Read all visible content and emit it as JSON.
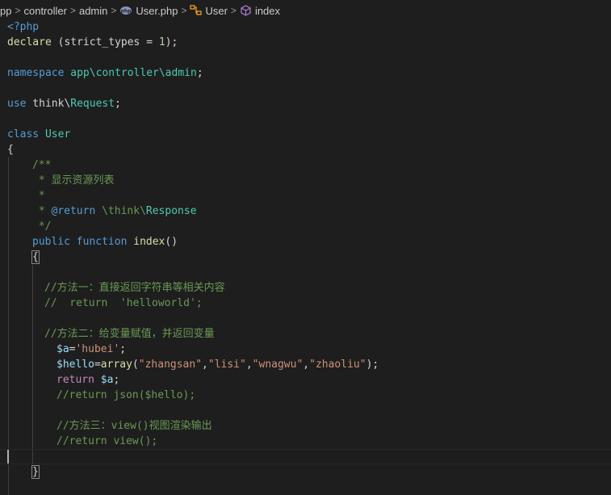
{
  "breadcrumb": {
    "items": [
      {
        "label": "pp",
        "icon": ""
      },
      {
        "label": "controller",
        "icon": ""
      },
      {
        "label": "admin",
        "icon": ""
      },
      {
        "label": "User.php",
        "icon": "php-file-icon"
      },
      {
        "label": "User",
        "icon": "class-icon"
      },
      {
        "label": "index",
        "icon": "method-icon"
      }
    ],
    "separator": ">"
  },
  "colors": {
    "background": "#1e1e1e",
    "keyword": "#569cd6",
    "control": "#c586c0",
    "function": "#dcdcaa",
    "type": "#4ec9b0",
    "variable": "#9cdcfe",
    "string": "#ce9178",
    "comment": "#6a9955",
    "number": "#b5cea8",
    "text": "#d4d4d4"
  },
  "code": {
    "l1": {
      "a": "<?php"
    },
    "l2": {
      "a": "declare",
      "b": " (strict_types = ",
      "c": "1",
      "d": ");"
    },
    "l4": {
      "a": "namespace",
      "b": " ",
      "c": "app\\controller\\admin",
      "d": ";"
    },
    "l6": {
      "a": "use",
      "b": " think\\",
      "c": "Request",
      "d": ";"
    },
    "l8": {
      "a": "class",
      "b": " ",
      "c": "User"
    },
    "l9": {
      "a": "{"
    },
    "l10": {
      "a": "/**"
    },
    "l11": {
      "a": " * 显示资源列表"
    },
    "l12": {
      "a": " *"
    },
    "l13": {
      "a": " * ",
      "b": "@return",
      "c": " \\think\\",
      "d": "Response"
    },
    "l14": {
      "a": " */"
    },
    "l15": {
      "a": "public",
      "b": " ",
      "c": "function",
      "d": " ",
      "e": "index",
      "f": "()"
    },
    "l16": {
      "a": "{"
    },
    "l18": {
      "a": "//方法一：直接返回字符串等相关内容"
    },
    "l19": {
      "a": "//  return  'helloworld';"
    },
    "l21": {
      "a": "//方法二：给变量赋值，并返回变量"
    },
    "l22": {
      "a": "$a",
      "b": "=",
      "c": "'hubei'",
      "d": ";"
    },
    "l23": {
      "a": "$hello",
      "b": "=",
      "c": "array",
      "d": "(",
      "e": "\"zhangsan\"",
      "f": ",",
      "g": "\"lisi\"",
      "h": ",",
      "i": "\"wnagwu\"",
      "j": ",",
      "k": "\"zhaoliu\"",
      "l": ");"
    },
    "l24": {
      "a": "return",
      "b": " ",
      "c": "$a",
      "d": ";"
    },
    "l25": {
      "a": "//return json($hello);"
    },
    "l27": {
      "a": "//方法三：view()视图渲染输出"
    },
    "l28": {
      "a": "//return view();"
    },
    "l30": {
      "a": "}"
    }
  }
}
